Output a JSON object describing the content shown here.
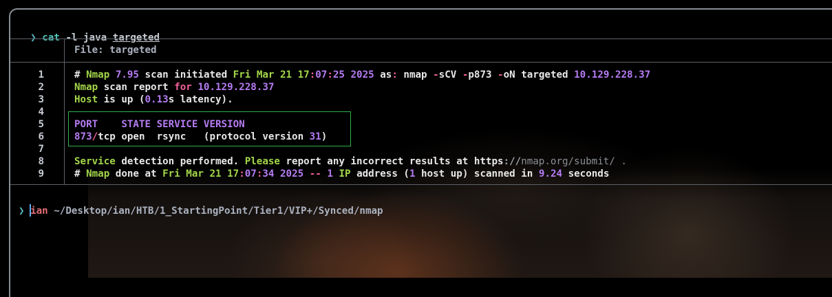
{
  "command": {
    "prompt_symbol": "❯",
    "cmd": "cat",
    "flags": "-l java",
    "file": "targeted"
  },
  "header": {
    "file_label": "File: targeted"
  },
  "lines": [
    {
      "num": "1",
      "segments": [
        {
          "t": "# ",
          "c": "white"
        },
        {
          "t": "Nmap",
          "c": "green"
        },
        {
          "t": " ",
          "c": "white"
        },
        {
          "t": "7.95",
          "c": "purple"
        },
        {
          "t": " scan initiated ",
          "c": "white"
        },
        {
          "t": "Fri Mar 21 17",
          "c": "green"
        },
        {
          "t": ":",
          "c": "pink"
        },
        {
          "t": "07",
          "c": "purple"
        },
        {
          "t": ":",
          "c": "pink"
        },
        {
          "t": "25 2025",
          "c": "purple"
        },
        {
          "t": " as",
          "c": "white"
        },
        {
          "t": ":",
          "c": "pink"
        },
        {
          "t": " nmap ",
          "c": "white"
        },
        {
          "t": "-",
          "c": "pink"
        },
        {
          "t": "sCV ",
          "c": "white"
        },
        {
          "t": "-",
          "c": "pink"
        },
        {
          "t": "p873 ",
          "c": "white"
        },
        {
          "t": "-",
          "c": "pink"
        },
        {
          "t": "oN targeted ",
          "c": "white"
        },
        {
          "t": "10.129.228.37",
          "c": "purple"
        }
      ]
    },
    {
      "num": "2",
      "segments": [
        {
          "t": "Nmap",
          "c": "green"
        },
        {
          "t": " scan report ",
          "c": "white"
        },
        {
          "t": "for",
          "c": "pink"
        },
        {
          "t": " ",
          "c": "white"
        },
        {
          "t": "10.129.228.37",
          "c": "purple"
        }
      ]
    },
    {
      "num": "3",
      "segments": [
        {
          "t": "Host",
          "c": "green"
        },
        {
          "t": " is up (",
          "c": "white"
        },
        {
          "t": "0.13",
          "c": "purple"
        },
        {
          "t": "s latency).",
          "c": "white"
        }
      ]
    },
    {
      "num": "4",
      "segments": []
    },
    {
      "num": "5",
      "segments": [
        {
          "t": "PORT    STATE SERVICE VERSION",
          "c": "purple"
        }
      ]
    },
    {
      "num": "6",
      "segments": [
        {
          "t": "873",
          "c": "purple"
        },
        {
          "t": "/",
          "c": "pink"
        },
        {
          "t": "tcp open  rsync   (protocol version ",
          "c": "white"
        },
        {
          "t": "31",
          "c": "purple"
        },
        {
          "t": ")",
          "c": "white"
        }
      ]
    },
    {
      "num": "7",
      "segments": []
    },
    {
      "num": "8",
      "segments": [
        {
          "t": "Service",
          "c": "green"
        },
        {
          "t": " detection performed. ",
          "c": "white"
        },
        {
          "t": "Please",
          "c": "green"
        },
        {
          "t": " report any incorrect results at https",
          "c": "white"
        },
        {
          "t": "://",
          "c": "gray"
        },
        {
          "t": "nmap.org/submit/ .",
          "c": "dim"
        }
      ]
    },
    {
      "num": "9",
      "segments": [
        {
          "t": "# ",
          "c": "white"
        },
        {
          "t": "Nmap",
          "c": "green"
        },
        {
          "t": " done at ",
          "c": "white"
        },
        {
          "t": "Fri Mar 21 17",
          "c": "green"
        },
        {
          "t": ":",
          "c": "pink"
        },
        {
          "t": "07",
          "c": "purple"
        },
        {
          "t": ":",
          "c": "pink"
        },
        {
          "t": "34 2025",
          "c": "purple"
        },
        {
          "t": " ",
          "c": "white"
        },
        {
          "t": "--",
          "c": "pink"
        },
        {
          "t": " ",
          "c": "white"
        },
        {
          "t": "1",
          "c": "purple"
        },
        {
          "t": " ",
          "c": "white"
        },
        {
          "t": "IP",
          "c": "green"
        },
        {
          "t": " address (",
          "c": "white"
        },
        {
          "t": "1",
          "c": "purple"
        },
        {
          "t": " host up) scanned in ",
          "c": "white"
        },
        {
          "t": "9.24",
          "c": "purple"
        },
        {
          "t": " seconds",
          "c": "white"
        }
      ]
    }
  ],
  "status": {
    "user": "ian",
    "path": "~/Desktop/ian/HTB/1_StartingPoint/Tier1/VIP+/Synced/nmap",
    "prompt_symbol": "❯"
  },
  "colors": {
    "green": "#a3d64a",
    "purple": "#b57cf2",
    "pink": "#f0609a",
    "white": "#e8e8e8",
    "highlight_box": "#2fb34a",
    "frame": "#8a8f96"
  }
}
